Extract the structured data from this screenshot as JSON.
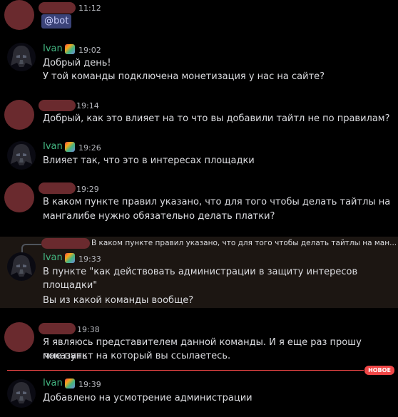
{
  "messages": [
    {
      "id": "m1",
      "author": "",
      "time": "11:12",
      "mention": "@bot",
      "lines": []
    },
    {
      "id": "m2",
      "author": "Ivan",
      "time": "19:02",
      "lines": [
        "Добрый день!",
        "У той команды подключена монетизация у нас на сайте?"
      ]
    },
    {
      "id": "m3",
      "author": "",
      "time": "19:14",
      "lines": [
        "Добрый, как это влияет на то что вы добавили тайтл не по правилам?"
      ]
    },
    {
      "id": "m4",
      "author": "Ivan",
      "time": "19:26",
      "lines": [
        "Влияет так, что это в интересах площадки"
      ]
    },
    {
      "id": "m5",
      "author": "",
      "time": "19:29",
      "lines": [
        "В каком пункте правил указано, что для того чтобы делать тайтлы на",
        "мангалибе нужно обязательно делать платки?"
      ]
    },
    {
      "id": "m6",
      "author": "Ivan",
      "time": "19:33",
      "reply_preview": "В каком пункте правил указано, что для того чтобы делать тайтлы на ман...",
      "lines": [
        "В пункте \"как действовать администрации в защиту интересов площадки\"",
        "",
        "Вы из какой команды вообще?"
      ]
    },
    {
      "id": "m7",
      "author": "",
      "time": "19:38",
      "lines": [
        "Я являюсь представителем данной команды. И я еще раз прошу показать",
        "мне пункт на который вы ссылаетесь."
      ]
    },
    {
      "id": "m8",
      "author": "Ivan",
      "time": "19:39",
      "lines": [
        "Добавлено на усмотрение администрации"
      ]
    }
  ],
  "divider": {
    "label": "НОВОЕ"
  },
  "colors": {
    "background": "#000000",
    "username_ivan": "#43b581",
    "mention_bg": "#3b4378",
    "new_divider": "#f04747"
  },
  "icons": {
    "ivan_avatar": "darth-vader-avatar-icon",
    "badge": "rainbow-badge-icon"
  }
}
